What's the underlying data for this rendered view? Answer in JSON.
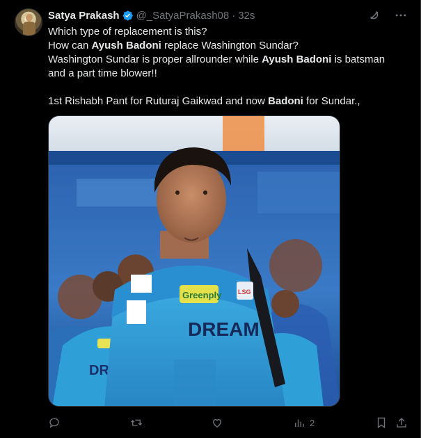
{
  "post": {
    "author_name": "Satya Prakash",
    "handle": "@_SatyaPrakash08",
    "separator": "·",
    "time": "32s",
    "lines": [
      {
        "pre": "Which type of replacement is this?",
        "bold": "",
        "post": ""
      },
      {
        "pre": "How can ",
        "bold": "Ayush Badoni",
        "post": " replace Washington Sundar?"
      },
      {
        "pre": "Washington Sundar is proper allrounder while ",
        "bold": "Ayush Badoni",
        "post": " is batsman"
      },
      {
        "pre": "and a part time blower!!",
        "bold": "",
        "post": ""
      },
      {
        "pre": "1st Rishabh Pant for Ruturaj Gaikwad and now ",
        "bold": "Badoni",
        "post": " for Sundar.,"
      }
    ]
  },
  "image": {
    "jersey_texts": [
      "Greenply",
      "DREAM",
      "DRE",
      "LSG"
    ],
    "colors": {
      "jersey": "#2f9fd8",
      "background": "#2a5fa8"
    }
  },
  "actions": {
    "reply_count": "",
    "retweet_count": "",
    "like_count": "",
    "views_count": "2"
  },
  "icons": {
    "verified": "verified-badge-icon",
    "grok": "grok-icon",
    "more": "more-options-icon",
    "reply": "reply-icon",
    "retweet": "retweet-icon",
    "like": "like-icon",
    "views": "views-icon",
    "bookmark": "bookmark-icon",
    "share": "share-icon"
  },
  "colors": {
    "background": "#000000",
    "text": "#e7e9ea",
    "muted": "#71767b",
    "accent": "#1d9bf0"
  }
}
